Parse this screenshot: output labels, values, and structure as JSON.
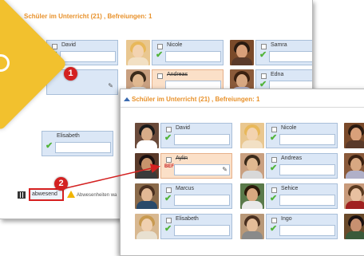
{
  "background_panel": {
    "title": "Schüler im Unterricht (21) , Befreiungen: 1",
    "bottom_button_label": "abwesend",
    "bottom_text": "Abwesenheiten wa",
    "students": [
      {
        "name": "David",
        "status": "present"
      },
      {
        "name": "Nicole",
        "status": "present"
      },
      {
        "name": "Samra",
        "status": "present"
      },
      {
        "name": "Andreas",
        "status": "present",
        "strike": true
      },
      {
        "name": "Edna",
        "status": "present"
      },
      {
        "name": "Elisabeth",
        "status": "present"
      }
    ]
  },
  "front_panel": {
    "title": "Schüler im Unterricht (21) , Befreiungen: 1",
    "students": [
      {
        "name": "David",
        "status": "present"
      },
      {
        "name": "Nicole",
        "status": "present"
      },
      {
        "name": "Aylin",
        "status": "exempt",
        "strike": true,
        "badge": "BEF"
      },
      {
        "name": "Andreas",
        "status": "present"
      },
      {
        "name": "Marcus",
        "status": "present"
      },
      {
        "name": "Sehice",
        "status": "present"
      },
      {
        "name": "Elisabeth",
        "status": "present"
      },
      {
        "name": "Ingo",
        "status": "present"
      }
    ]
  },
  "callouts": [
    "1",
    "2"
  ],
  "colors": {
    "title_orange": "#e8912a",
    "card_blue": "#dbe7f6",
    "card_exempt": "#fbe0c8",
    "check_green": "#52b43a",
    "callout_red": "#d42121"
  },
  "icons": [
    "checkmark-icon",
    "edit-icon",
    "warning-icon",
    "collapse-arrow-icon"
  ]
}
